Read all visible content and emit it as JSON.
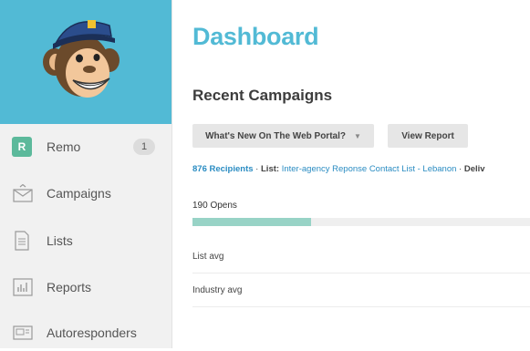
{
  "sidebar": {
    "user": {
      "initial": "R",
      "name": "Remo",
      "count": "1"
    },
    "items": [
      {
        "label": "Campaigns",
        "icon": "envelope-icon"
      },
      {
        "label": "Lists",
        "icon": "document-icon"
      },
      {
        "label": "Reports",
        "icon": "bar-chart-icon"
      },
      {
        "label": "Autoresponders",
        "icon": "autoresponder-icon"
      }
    ]
  },
  "colors": {
    "brand": "#52bad5",
    "badge": "#5cb99b",
    "progress": "#98d3c6",
    "link": "#2a8cc2"
  },
  "main": {
    "title": "Dashboard",
    "section_title": "Recent Campaigns",
    "dropdown_label": "What's New On The Web Portal?",
    "view_report_label": "View Report",
    "meta": {
      "recipients": "876 Recipients",
      "sep1": " · ",
      "list_label": "List:",
      "list_name": " Inter-agency Reponse Contact List - Lebanon",
      "sep2": " · ",
      "delivered": "Deliv"
    },
    "opens_label": "190 Opens",
    "opens_progress_pct": 35,
    "rows": [
      {
        "label": "List avg"
      },
      {
        "label": "Industry avg"
      }
    ]
  }
}
